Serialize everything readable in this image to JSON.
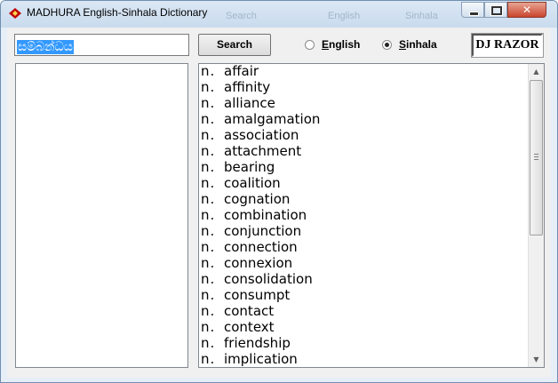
{
  "window": {
    "title": "MADHURA English-Sinhala Dictionary",
    "ghost_texts": [
      "Search",
      "English",
      "Sinhala"
    ],
    "close_glyph": "✕"
  },
  "toolbar": {
    "query_value": "සම්බන්ධය",
    "search_label": "Search",
    "language_options": [
      {
        "label": "English",
        "selected": false
      },
      {
        "label": "Sinhala",
        "selected": true
      }
    ],
    "brand": "DJ RAZOR"
  },
  "results": {
    "items": [
      {
        "pos": "n.",
        "word": "affair"
      },
      {
        "pos": "n.",
        "word": "affinity"
      },
      {
        "pos": "n.",
        "word": "alliance"
      },
      {
        "pos": "n.",
        "word": "amalgamation"
      },
      {
        "pos": "n.",
        "word": "association"
      },
      {
        "pos": "n.",
        "word": "attachment"
      },
      {
        "pos": "n.",
        "word": "bearing"
      },
      {
        "pos": "n.",
        "word": "coalition"
      },
      {
        "pos": "n.",
        "word": "cognation"
      },
      {
        "pos": "n.",
        "word": "combination"
      },
      {
        "pos": "n.",
        "word": "conjunction"
      },
      {
        "pos": "n.",
        "word": "connection"
      },
      {
        "pos": "n.",
        "word": "connexion"
      },
      {
        "pos": "n.",
        "word": "consolidation"
      },
      {
        "pos": "n.",
        "word": "consumpt"
      },
      {
        "pos": "n.",
        "word": "contact"
      },
      {
        "pos": "n.",
        "word": "context"
      },
      {
        "pos": "n.",
        "word": "friendship"
      },
      {
        "pos": "n.",
        "word": "implication"
      }
    ]
  },
  "colors": {
    "selection": "#3399ff",
    "close_button": "#c9452e"
  }
}
